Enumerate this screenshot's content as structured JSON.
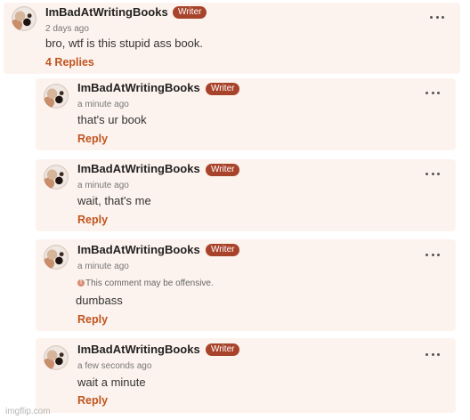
{
  "comment": {
    "username": "ImBadAtWritingBooks",
    "badge": "Writer",
    "time": "2 days ago",
    "text": "bro, wtf is this stupid ass book.",
    "replies_link": "4 Replies"
  },
  "replies": [
    {
      "username": "ImBadAtWritingBooks",
      "badge": "Writer",
      "time": "a minute ago",
      "text": "that's ur book",
      "reply_label": "Reply"
    },
    {
      "username": "ImBadAtWritingBooks",
      "badge": "Writer",
      "time": "a minute ago",
      "text": "wait, that's me",
      "reply_label": "Reply"
    },
    {
      "username": "ImBadAtWritingBooks",
      "badge": "Writer",
      "time": "a minute ago",
      "warning": "This comment may be offensive.",
      "text": "dumbass",
      "reply_label": "Reply"
    },
    {
      "username": "ImBadAtWritingBooks",
      "badge": "Writer",
      "time": "a few seconds ago",
      "text": "wait a minute",
      "reply_label": "Reply"
    }
  ],
  "icons": {
    "avatar": "avatar-dog-photo",
    "more": "more-options-icon",
    "warning": "warning-icon"
  },
  "colors": {
    "card_background": "#fdf3ee",
    "badge": "#a8432b",
    "reply_link": "#c0551f"
  },
  "watermark": "imgflip.com"
}
